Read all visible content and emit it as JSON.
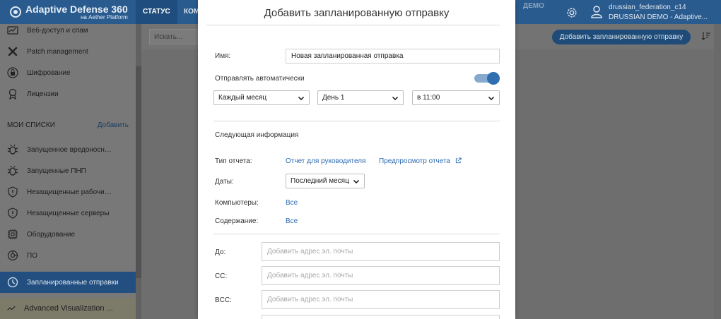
{
  "app": {
    "brand": "Adaptive Defense 360",
    "brand_sub": "на Aether Platform",
    "tabs": [
      "СТАТУС",
      "КОМ"
    ],
    "demo_label": "ДЕМО",
    "account_name": "drussian_federation_c14",
    "account_org": "DRUSSIAN DEMO - Adaptive..."
  },
  "sidebar": {
    "items": [
      {
        "label": "Веб-доступ и спам",
        "icon": "web-access-icon"
      },
      {
        "label": "Patch management",
        "icon": "patch-icon"
      },
      {
        "label": "Шифрование",
        "icon": "encryption-icon"
      },
      {
        "label": "Лицензии",
        "icon": "license-icon"
      }
    ],
    "section_title": "МОИ СПИСКИ",
    "section_add": "Добавить",
    "lists": [
      {
        "label": "Запущенное вредоносно...",
        "icon": "malware-icon"
      },
      {
        "label": "Запущенные ПНП",
        "icon": "pup-icon"
      },
      {
        "label": "Незащищенные рабочие...",
        "icon": "shield-icon"
      },
      {
        "label": "Незащищенные серверы",
        "icon": "shield-icon"
      },
      {
        "label": "Оборудование",
        "icon": "hardware-icon"
      },
      {
        "label": "ПО",
        "icon": "software-icon"
      }
    ],
    "active_item": "Запланированные отправки",
    "advanced": "Advanced Visualization ..."
  },
  "content": {
    "search_placeholder": "Искать...",
    "add_button": "Добавить запланированную отправку"
  },
  "modal": {
    "title": "Добавить запланированную отправку",
    "name_label": "Имя:",
    "name_value": "Новая запланированная отправка",
    "auto_send_label": "Отправлять автоматически",
    "auto_send_on": true,
    "frequency": "Каждый месяц",
    "day": "День 1",
    "time": "в 11:00",
    "info_heading": "Следующая информация",
    "report_type_label": "Тип отчета:",
    "report_type_value": "Отчет для руководителя",
    "preview_link": "Предпросмотр отчета",
    "dates_label": "Даты:",
    "dates_value": "Последний месяц",
    "computers_label": "Компьютеры:",
    "computers_value": "Все",
    "content_label": "Содержание:",
    "content_value": "Все",
    "to_label": "До:",
    "cc_label": "CC:",
    "bcc_label": "BCC:",
    "email_placeholder": "Добавить адрес эл. почты"
  },
  "colors": {
    "topbar": "#2a5b8e",
    "accent": "#2d6bb1",
    "toggle_on": "#2f6fb0"
  }
}
